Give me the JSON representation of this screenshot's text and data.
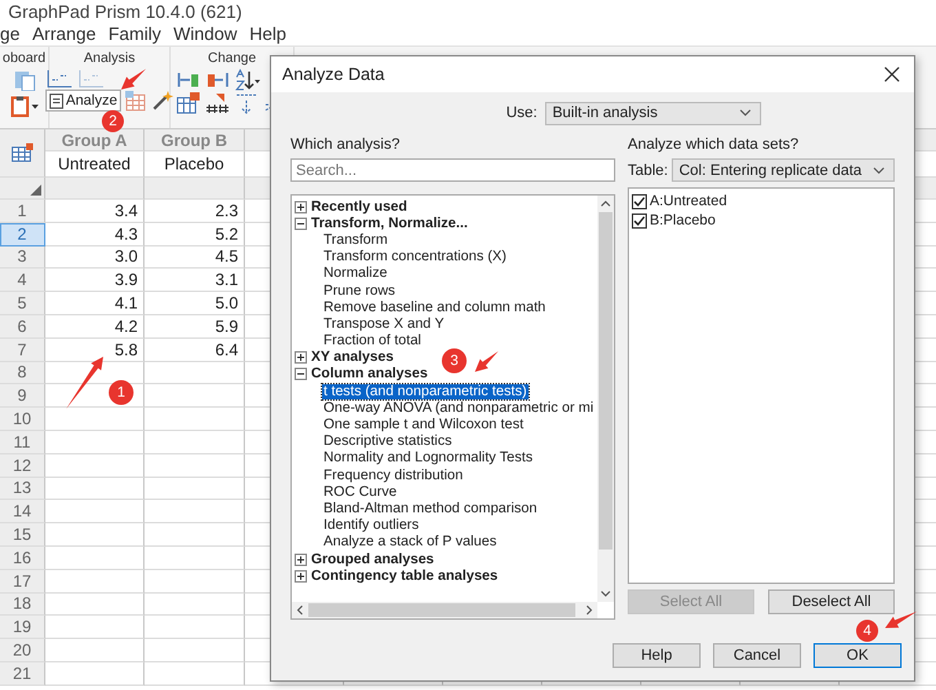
{
  "app": {
    "title": "GraphPad Prism 10.4.0 (621)",
    "menu": [
      "ge",
      "Arrange",
      "Family",
      "Window",
      "Help"
    ],
    "ribbon_groups": [
      {
        "label": "oboard"
      },
      {
        "label": "Analysis"
      },
      {
        "label": "Change"
      }
    ],
    "analyze_button": "Analyze"
  },
  "sheet": {
    "columns": [
      {
        "title": "Group A",
        "subtitle": "Untreated"
      },
      {
        "title": "Group B",
        "subtitle": "Placebo"
      }
    ],
    "rows": [
      {
        "number": "1",
        "selected": false,
        "cells": [
          "3.4",
          "2.3"
        ]
      },
      {
        "number": "2",
        "selected": true,
        "cells": [
          "4.3",
          "5.2"
        ]
      },
      {
        "number": "3",
        "selected": false,
        "cells": [
          "3.0",
          "4.5"
        ]
      },
      {
        "number": "4",
        "selected": false,
        "cells": [
          "3.9",
          "3.1"
        ]
      },
      {
        "number": "5",
        "selected": false,
        "cells": [
          "4.1",
          "5.0"
        ]
      },
      {
        "number": "6",
        "selected": false,
        "cells": [
          "4.2",
          "5.9"
        ]
      },
      {
        "number": "7",
        "selected": false,
        "cells": [
          "5.8",
          "6.4"
        ]
      },
      {
        "number": "8",
        "selected": false
      },
      {
        "number": "9",
        "selected": false
      },
      {
        "number": "10",
        "selected": false
      },
      {
        "number": "11",
        "selected": false
      },
      {
        "number": "12",
        "selected": false
      },
      {
        "number": "13",
        "selected": false
      },
      {
        "number": "14",
        "selected": false
      },
      {
        "number": "15",
        "selected": false
      },
      {
        "number": "16",
        "selected": false
      },
      {
        "number": "17",
        "selected": false
      },
      {
        "number": "18",
        "selected": false
      },
      {
        "number": "19",
        "selected": false
      },
      {
        "number": "20",
        "selected": false
      },
      {
        "number": "21",
        "selected": false
      }
    ]
  },
  "dialog": {
    "title": "Analyze Data",
    "use_label": "Use:",
    "use_value": "Built-in analysis",
    "which_label": "Which analysis?",
    "search_placeholder": "Search...",
    "tree": [
      {
        "label": "Recently used",
        "expanded": false
      },
      {
        "label": "Transform, Normalize...",
        "expanded": true,
        "children": [
          {
            "label": "Transform",
            "selected": false
          },
          {
            "label": "Transform concentrations (X)",
            "selected": false
          },
          {
            "label": "Normalize",
            "selected": false
          },
          {
            "label": "Prune rows",
            "selected": false
          },
          {
            "label": "Remove baseline and column math",
            "selected": false
          },
          {
            "label": "Transpose X and Y",
            "selected": false
          },
          {
            "label": "Fraction of total",
            "selected": false
          }
        ]
      },
      {
        "label": "XY analyses",
        "expanded": false
      },
      {
        "label": "Column analyses",
        "expanded": true,
        "children": [
          {
            "label": "t tests (and nonparametric tests)",
            "selected": true
          },
          {
            "label": "One-way ANOVA (and nonparametric or mi",
            "selected": false
          },
          {
            "label": "One sample t and Wilcoxon test",
            "selected": false
          },
          {
            "label": "Descriptive statistics",
            "selected": false
          },
          {
            "label": "Normality and Lognormality Tests",
            "selected": false
          },
          {
            "label": "Frequency distribution",
            "selected": false
          },
          {
            "label": "ROC Curve",
            "selected": false
          },
          {
            "label": "Bland-Altman method comparison",
            "selected": false
          },
          {
            "label": "Identify outliers",
            "selected": false
          },
          {
            "label": "Analyze a stack of P values",
            "selected": false
          }
        ]
      },
      {
        "label": "Grouped analyses",
        "expanded": false
      },
      {
        "label": "Contingency table analyses",
        "expanded": false
      }
    ],
    "datasets_label": "Analyze which data sets?",
    "table_label": "Table:",
    "table_value": "Col: Entering replicate data",
    "datasets": [
      {
        "label": "A:Untreated",
        "checked": true
      },
      {
        "label": "B:Placebo",
        "checked": true
      }
    ],
    "list_buttons": [
      {
        "label": "Select All",
        "disabled": true
      },
      {
        "label": "Deselect All",
        "disabled": false
      }
    ],
    "footer_buttons": [
      {
        "label": "Help",
        "default": false
      },
      {
        "label": "Cancel",
        "default": false
      },
      {
        "label": "OK",
        "default": true
      }
    ]
  },
  "annotations": [
    {
      "number": "1"
    },
    {
      "number": "2"
    },
    {
      "number": "3"
    },
    {
      "number": "4"
    }
  ]
}
